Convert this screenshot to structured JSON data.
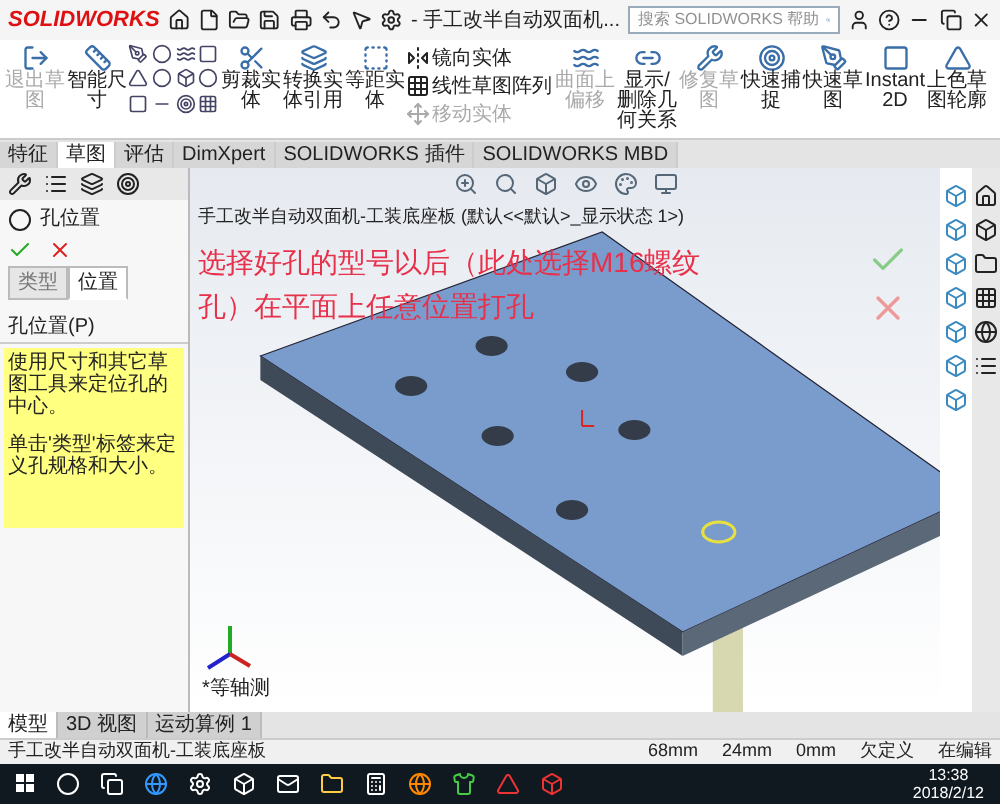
{
  "title_bar": {
    "app_name": "SOLIDWORKS",
    "document_title": "- 手工改半自动双面机...",
    "search_placeholder": "搜索 SOLIDWORKS 帮助"
  },
  "ribbon": [
    {
      "label": "退出草图",
      "disabled": true
    },
    {
      "label": "智能尺寸",
      "disabled": false
    },
    {
      "label": "剪裁实体",
      "disabled": false
    },
    {
      "label": "转换实体引用",
      "disabled": false
    },
    {
      "label": "等距实体",
      "disabled": false
    },
    {
      "label": "曲面上偏移",
      "disabled": true
    },
    {
      "label": "显示/删除几何关系",
      "disabled": false
    },
    {
      "label": "修复草图",
      "disabled": true
    },
    {
      "label": "快速捕捉",
      "disabled": false
    },
    {
      "label": "快速草图",
      "disabled": false
    },
    {
      "label": "Instant2D",
      "disabled": false
    },
    {
      "label": "上色草图轮廓",
      "disabled": false
    }
  ],
  "ribbon_side": [
    {
      "label": "镜向实体",
      "disabled": false
    },
    {
      "label": "线性草图阵列",
      "disabled": false
    },
    {
      "label": "移动实体",
      "disabled": true
    }
  ],
  "command_tabs": [
    {
      "label": "特征",
      "selected": false
    },
    {
      "label": "草图",
      "selected": true
    },
    {
      "label": "评估",
      "selected": false
    },
    {
      "label": "DimXpert",
      "selected": false
    },
    {
      "label": "SOLIDWORKS 插件",
      "selected": false
    },
    {
      "label": "SOLIDWORKS MBD",
      "selected": false
    }
  ],
  "property_manager": {
    "title": "孔位置",
    "tabs": [
      {
        "label": "类型",
        "selected": false
      },
      {
        "label": "位置",
        "selected": true
      }
    ],
    "section_title": "孔位置(P)",
    "messages": [
      "使用尺寸和其它草图工具来定位孔的中心。",
      "单击'类型'标签来定义孔规格和大小。"
    ]
  },
  "viewport": {
    "breadcrumb": "手工改半自动双面机-工装底座板 (默认<<默认>_显示状态 1>)",
    "annotation": "选择好孔的型号以后（此处选择M16螺纹孔）在平面上任意位置打孔",
    "view_label": "*等轴测"
  },
  "bottom_tabs": [
    {
      "label": "模型",
      "selected": true
    },
    {
      "label": "3D 视图",
      "selected": false
    },
    {
      "label": "运动算例 1",
      "selected": false
    }
  ],
  "status_bar": {
    "document": "手工改半自动双面机-工装底座板",
    "fields": [
      "68mm",
      "24mm",
      "0mm",
      "欠定义",
      "在编辑"
    ]
  },
  "taskbar": {
    "time": "13:38",
    "date": "2018/2/12"
  }
}
